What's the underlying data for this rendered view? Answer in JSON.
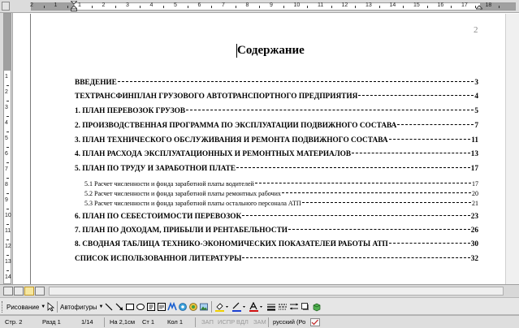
{
  "ruler": {
    "h_numbers": [
      "2",
      "1",
      "1",
      "2",
      "3",
      "4",
      "5",
      "6",
      "7",
      "8",
      "9",
      "10",
      "11",
      "12",
      "13",
      "14",
      "15",
      "16",
      "17",
      "18"
    ],
    "v_numbers": [
      "1",
      "2",
      "3",
      "4",
      "5",
      "6",
      "7",
      "8",
      "9",
      "10",
      "11",
      "12",
      "13",
      "14"
    ]
  },
  "document": {
    "page_number": "2",
    "title": "Содержание",
    "toc_main": [
      {
        "text": "ВВЕДЕНИЕ",
        "page": "3"
      },
      {
        "text": "ТЕХТРАНСФИНПЛАН ГРУЗОВОГО АВТОТРАНСПОРТНОГО ПРЕДПРИЯТИЯ",
        "page": "4"
      },
      {
        "text": "1. ПЛАН ПЕРЕВОЗОК ГРУЗОВ",
        "page": "5"
      },
      {
        "text": "2. ПРОИЗВОДСТВЕННАЯ ПРОГРАММА ПО ЭКСПЛУАТАЦИИ ПОДВИЖНОГО СОСТАВА",
        "page": "7"
      },
      {
        "text": "3. ПЛАН ТЕХНИЧЕСКОГО ОБСЛУЖИВАНИЯ И РЕМОНТА ПОДВИЖНОГО СОСТАВА",
        "page": "11"
      },
      {
        "text": "4. ПЛАН РАСХОДА ЭКСПЛУАТАЦИОННЫХ И РЕМОНТНЫХ МАТЕРИАЛОВ",
        "page": "13"
      },
      {
        "text": "5. ПЛАН ПО ТРУДУ И ЗАРАБОТНОЙ ПЛАТЕ",
        "page": "17"
      }
    ],
    "toc_sub": [
      {
        "text": "5.1 Расчет численности и фонда заработной платы водителей",
        "page": "17"
      },
      {
        "text": "5.2 Расчет численности и фонда заработной платы ремонтных рабочих",
        "page": "20"
      },
      {
        "text": "5.3 Расчет численности и фонда заработной платы остального персонала АТП",
        "page": "21"
      }
    ],
    "toc_main2": [
      {
        "text": "6. ПЛАН ПО СЕБЕСТОИМОСТИ ПЕРЕВОЗОК",
        "page": "23"
      },
      {
        "text": "7. ПЛАН ПО ДОХОДАМ, ПРИБЫЛИ И РЕНТАБЕЛЬНОСТИ",
        "page": "26"
      },
      {
        "text": "8. СВОДНАЯ ТАБЛИЦА ТЕХНИКО-ЭКОНОМИЧЕСКИХ ПОКАЗАТЕЛЕЙ РАБОТЫ АТП",
        "page": "30"
      },
      {
        "text": "СПИСОК ИСПОЛЬЗОВАННОЙ ЛИТЕРАТУРЫ",
        "page": "32"
      }
    ]
  },
  "drawing_toolbar": {
    "draw_menu": "Рисование",
    "autoshapes_menu": "Автофигуры",
    "icons": [
      "cursor-icon",
      "line-icon",
      "arrow-icon",
      "rectangle-icon",
      "oval-icon",
      "textbox-icon",
      "vertical-textbox-icon",
      "wordart-icon",
      "diagram-icon",
      "clipart-icon",
      "picture-icon",
      "fill-color-icon",
      "line-color-icon",
      "font-color-icon",
      "line-style-icon",
      "dash-style-icon",
      "arrow-style-icon",
      "shadow-icon",
      "3d-icon"
    ],
    "accent_fill": "#f0d000",
    "accent_line": "#1a3fd0",
    "accent_font": "#d01010"
  },
  "status": {
    "page": "Стр. 2",
    "section": "Разд 1",
    "pages": "1/14",
    "position": "На 2,1см",
    "line": "Ст 1",
    "column": "Кол 1",
    "rec": "ЗАП",
    "trk": "ИСПР",
    "ext": "ВДЛ",
    "ovr": "ЗАМ",
    "language": "русский (Ро"
  }
}
